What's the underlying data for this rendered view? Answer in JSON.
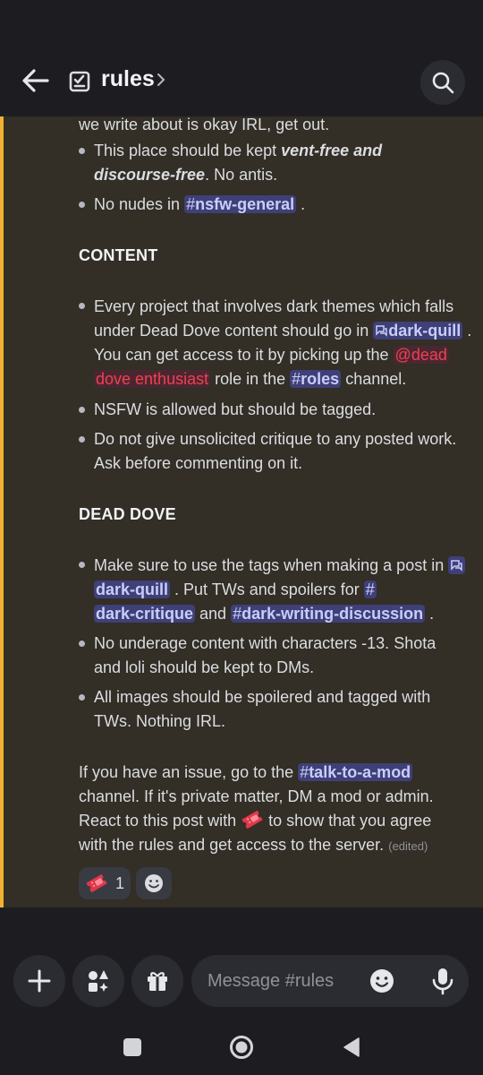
{
  "header": {
    "title": "rules",
    "back_icon": "arrow-left-icon",
    "channel_icon": "rules-channel-icon",
    "search_icon": "search-icon"
  },
  "message": {
    "l0": "we write about is okay IRL, get out.",
    "r1_a": "This place should be kept ",
    "r1_b": "vent-free and",
    "r1_c": "discourse-free",
    "r1_d": ". No antis.",
    "r2_a": "No nudes in ",
    "ch_nsfw_general": "nsfw-general",
    "r2_b": " .",
    "heading_content": "CONTENT",
    "c1_a": "Every project that involves dark themes which falls",
    "c1_b": "under Dead Dove content should go in ",
    "ch_dark_quill": "dark-quill",
    "c1_c": " .",
    "c1_d": "You can get access to it by picking up the ",
    "role_a": "@dead",
    "role_b": "dove enthusiast",
    "c1_e": " role in the ",
    "ch_roles": "roles",
    "c1_f": " channel.",
    "c2": "NSFW is allowed but should be tagged.",
    "c3_a": "Do not give unsolicited critique to any posted work.",
    "c3_b": "Ask before commenting on it.",
    "heading_dead_dove": "DEAD DOVE",
    "d1_a": "Make sure to use the tags when making a post in ",
    "ch_dark_quill_2": "dark-quill",
    "d1_b": " . Put TWs and spoilers for ",
    "ch_dark_critique": "dark-critique",
    "d1_c": " and ",
    "ch_dark_writing_discussion": "dark-writing-discussion",
    "d1_d": " .",
    "d2_a": "No underage content with characters -13. Shota",
    "d2_b": "and loli should be kept to DMs.",
    "d3_a": "All images should be spoilered and tagged with",
    "d3_b": "TWs. Nothing IRL.",
    "f1_a": "If you have an issue, go to the ",
    "ch_talk_to_a_mod": "talk-to-a-mod",
    "f2": "channel. If it's private matter, DM a mod or admin.",
    "f3_a": "React to this post with ",
    "f3_b": " to show that you agree",
    "f4": "with the rules and get access to the server.",
    "edited": "(edited)",
    "hash": "#"
  },
  "reactions": [
    {
      "icon": "ticket-icon",
      "count": "1"
    },
    {
      "icon": "add-reaction-icon"
    }
  ],
  "composer": {
    "placeholder": "Message #rules"
  },
  "colors": {
    "accent_bar": "#f0b232",
    "mention_bg": "#3e4077",
    "role_color": "#f23f52",
    "message_bg": "#332e26"
  }
}
